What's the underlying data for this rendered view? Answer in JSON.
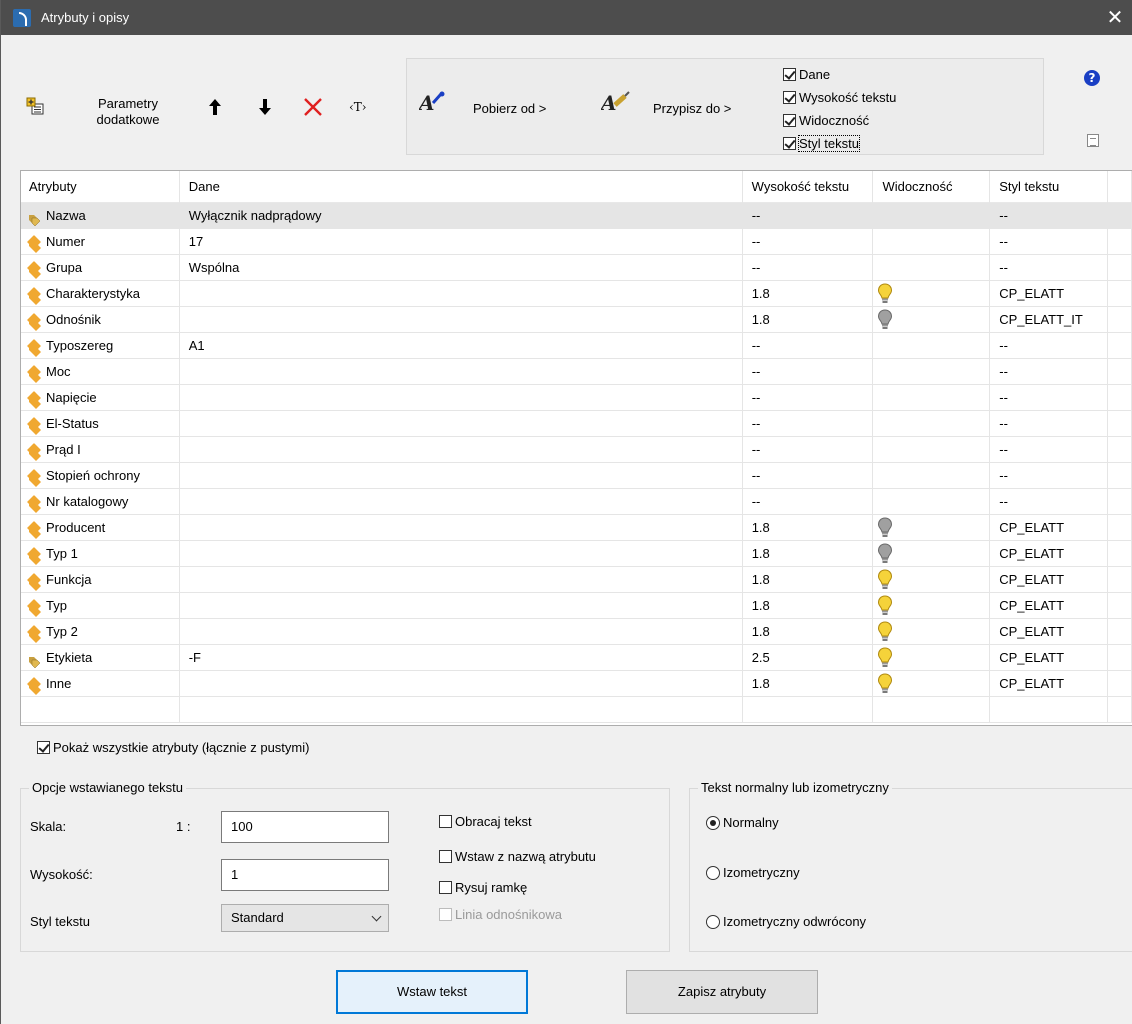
{
  "window": {
    "title": "Atrybuty i opisy",
    "close_glyph": "✕"
  },
  "toolbar": {
    "params_label_line1": "Parametry",
    "params_label_line2": "dodatkowe",
    "move_up_glyph": "🡑",
    "move_down_glyph": "🡓",
    "delete_glyph": "✕",
    "text_glyph": "‹T›",
    "get_from_label": "Pobierz od >",
    "assign_to_label": "Przypisz do >",
    "help_glyph": "?"
  },
  "copy_options": {
    "data": {
      "label": "Dane",
      "checked": true
    },
    "text_height": {
      "label": "Wysokość tekstu",
      "checked": true
    },
    "visibility": {
      "label": "Widoczność",
      "checked": true
    },
    "text_style": {
      "label": "Styl tekstu",
      "checked": true
    }
  },
  "table": {
    "columns": [
      "Atrybuty",
      "Dane",
      "Wysokość tekstu",
      "Widoczność",
      "Styl tekstu"
    ],
    "rows": [
      {
        "attr": "Nazwa",
        "data": "Wyłącznik nadprądowy",
        "height": "--",
        "visibility": "",
        "style": "--",
        "selected": true,
        "multi": true
      },
      {
        "attr": "Numer",
        "data": "17",
        "height": "--",
        "visibility": "",
        "style": "--"
      },
      {
        "attr": "Grupa",
        "data": "Wspólna",
        "height": "--",
        "visibility": "",
        "style": "--"
      },
      {
        "attr": "Charakterystyka",
        "data": "",
        "height": "1.8",
        "visibility": "on",
        "style": "CP_ELATT"
      },
      {
        "attr": "Odnośnik",
        "data": "",
        "height": "1.8",
        "visibility": "off",
        "style": "CP_ELATT_IT"
      },
      {
        "attr": "Typoszereg",
        "data": "A1",
        "height": "--",
        "visibility": "",
        "style": "--"
      },
      {
        "attr": "Moc",
        "data": "",
        "height": "--",
        "visibility": "",
        "style": "--"
      },
      {
        "attr": "Napięcie",
        "data": "",
        "height": "--",
        "visibility": "",
        "style": "--"
      },
      {
        "attr": "El-Status",
        "data": "",
        "height": "--",
        "visibility": "",
        "style": "--"
      },
      {
        "attr": "Prąd I",
        "data": "",
        "height": "--",
        "visibility": "",
        "style": "--"
      },
      {
        "attr": "Stopień ochrony",
        "data": "",
        "height": "--",
        "visibility": "",
        "style": "--"
      },
      {
        "attr": "Nr katalogowy",
        "data": "",
        "height": "--",
        "visibility": "",
        "style": "--"
      },
      {
        "attr": "Producent",
        "data": "",
        "height": "1.8",
        "visibility": "off",
        "style": "CP_ELATT"
      },
      {
        "attr": "Typ 1",
        "data": "",
        "height": "1.8",
        "visibility": "off",
        "style": "CP_ELATT"
      },
      {
        "attr": "Funkcja",
        "data": "",
        "height": "1.8",
        "visibility": "on",
        "style": "CP_ELATT"
      },
      {
        "attr": "Typ",
        "data": "",
        "height": "1.8",
        "visibility": "on",
        "style": "CP_ELATT"
      },
      {
        "attr": "Typ 2",
        "data": "",
        "height": "1.8",
        "visibility": "on",
        "style": "CP_ELATT"
      },
      {
        "attr": "Etykieta",
        "data": "-F",
        "height": "2.5",
        "visibility": "on",
        "style": "CP_ELATT",
        "multi": true
      },
      {
        "attr": "Inne",
        "data": "",
        "height": "1.8",
        "visibility": "on",
        "style": "CP_ELATT"
      }
    ]
  },
  "show_all": {
    "label": "Pokaż wszystkie atrybuty (łącznie z pustymi)",
    "checked": true
  },
  "insert_options": {
    "title": "Opcje wstawianego tekstu",
    "scale_label": "Skala:",
    "scale_prefix": "1 :",
    "scale_value": "100",
    "height_label": "Wysokość:",
    "height_value": "1",
    "style_label": "Styl tekstu",
    "style_value": "Standard",
    "rotate_label": "Obracaj tekst",
    "with_name_label": "Wstaw z nazwą atrybutu",
    "draw_frame_label": "Rysuj ramkę",
    "leader_label": "Linia odnośnikowa"
  },
  "text_mode": {
    "title": "Tekst normalny lub izometryczny",
    "normal": "Normalny",
    "iso": "Izometryczny",
    "iso_reversed": "Izometryczny odwrócony",
    "selected": "normal"
  },
  "buttons": {
    "insert_text": "Wstaw tekst",
    "save_attributes": "Zapisz atrybuty"
  },
  "colors": {
    "titlebar": "#4d4d4d",
    "accent": "#0078d7",
    "bulb_on": "#f5d33a",
    "bulb_off": "#a0a0a0",
    "tag": "#f0a830"
  }
}
